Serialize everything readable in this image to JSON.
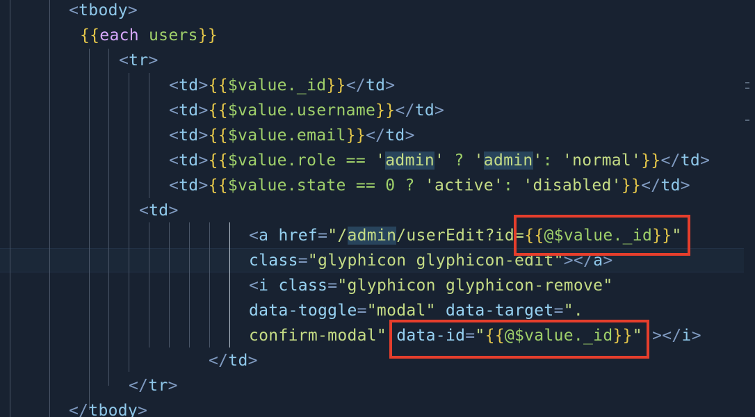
{
  "colors": {
    "background": "#182231",
    "tag": "#8fc8ea",
    "attribute": "#97d2f2",
    "string": "#c5dc85",
    "template_brace": "#e6c84a",
    "template_expression": "#9fd06a",
    "keyword": "#d8a8ff",
    "annotation_box": "#e53e2c"
  },
  "code": {
    "line_01": {
      "t1": "<",
      "t2": "tbody",
      "t3": ">"
    },
    "line_02": {
      "t1": "{{",
      "t2": "each",
      "t3": " users",
      "t4": "}}"
    },
    "line_03": {
      "t1": "<",
      "t2": "tr",
      "t3": ">"
    },
    "line_04": {
      "t1": "<",
      "t2": "td",
      "t3": ">",
      "t4": "{{",
      "t5": "$value._id",
      "t6": "}}",
      "t7": "</",
      "t8": "td",
      "t9": ">"
    },
    "line_05": {
      "t1": "<",
      "t2": "td",
      "t3": ">",
      "t4": "{{",
      "t5": "$value.username",
      "t6": "}}",
      "t7": "</",
      "t8": "td",
      "t9": ">"
    },
    "line_06": {
      "t1": "<",
      "t2": "td",
      "t3": ">",
      "t4": "{{",
      "t5": "$value.email",
      "t6": "}}",
      "t7": "</",
      "t8": "td",
      "t9": ">"
    },
    "line_07": {
      "t1": "<",
      "t2": "td",
      "t3": ">",
      "t4": "{{",
      "t5": "$value.role == ",
      "t6": "'",
      "t7": "admin",
      "t8": "'",
      "t9": " ? ",
      "t10": "'",
      "t11": "admin",
      "t12": "'",
      "t13": ": ",
      "t14": "'normal'",
      "t15": "}}",
      "t16": "</",
      "t17": "td",
      "t18": ">"
    },
    "line_08": {
      "t1": "<",
      "t2": "td",
      "t3": ">",
      "t4": "{{",
      "t5": "$value.state == 0 ? ",
      "t6": "'active'",
      "t7": ": ",
      "t8": "'disabled'",
      "t9": "}}",
      "t10": "</",
      "t11": "td",
      "t12": ">"
    },
    "line_09": {
      "t1": "<",
      "t2": "td",
      "t3": ">"
    },
    "line_10": {
      "t1": "<",
      "t2": "a",
      "t3": " href",
      "t4": "=",
      "t5": "\"/",
      "t6": "admin",
      "t7": "/userEdit?id=",
      "t8": "{{",
      "t9": "@$value._id",
      "t10": "}}",
      "t11": "\""
    },
    "line_11": {
      "t1": "class",
      "t2": "=",
      "t3": "\"glyphicon glyphicon-edit\"",
      "t4": "></",
      "t5": "a",
      "t6": ">"
    },
    "line_12": {
      "t1": "<",
      "t2": "i",
      "t3": " class",
      "t4": "=",
      "t5": "\"glyphicon glyphicon-remove\""
    },
    "line_13": {
      "t1": "data-toggle",
      "t2": "=",
      "t3": "\"modal\"",
      "t4": " data-target",
      "t5": "=",
      "t6": "\"."
    },
    "line_14": {
      "t1": "confirm-modal\"",
      "t2": " data-id",
      "t3": "=",
      "t4": "\"",
      "t5": "{{",
      "t6": "@$value._id",
      "t7": "}}",
      "t8": "\"",
      "t9": " ></",
      "t10": "i",
      "t11": ">"
    },
    "line_15": {
      "t1": "</",
      "t2": "td",
      "t3": ">"
    },
    "line_16": {
      "t1": "</",
      "t2": "tr",
      "t3": ">"
    },
    "line_17": {
      "t1": "</",
      "t2": "tbody",
      "t3": ">"
    }
  }
}
